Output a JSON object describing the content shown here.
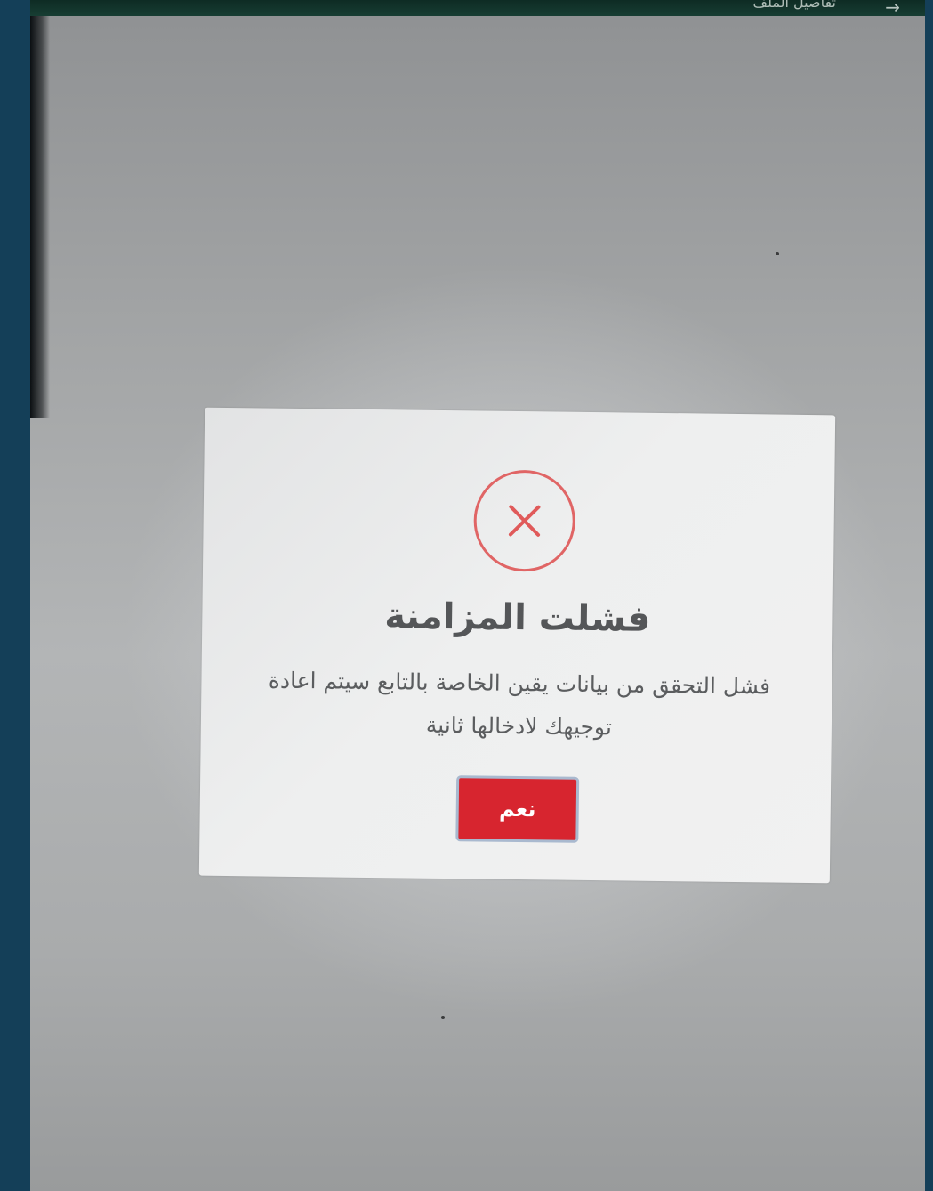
{
  "header": {
    "title": "تفاصيل الملف",
    "back_icon": "arrow-right-icon"
  },
  "dialog": {
    "status_icon": "error-x-icon",
    "title": "فشلت المزامنة",
    "message_line1": "فشل التحقق من بيانات يقين الخاصة بالتابع سيتم اعادة",
    "message_line2": "توجيهك لادخالها ثانية",
    "confirm_label": "نعم",
    "accent_color": "#d7252f",
    "icon_color": "#e06565"
  }
}
